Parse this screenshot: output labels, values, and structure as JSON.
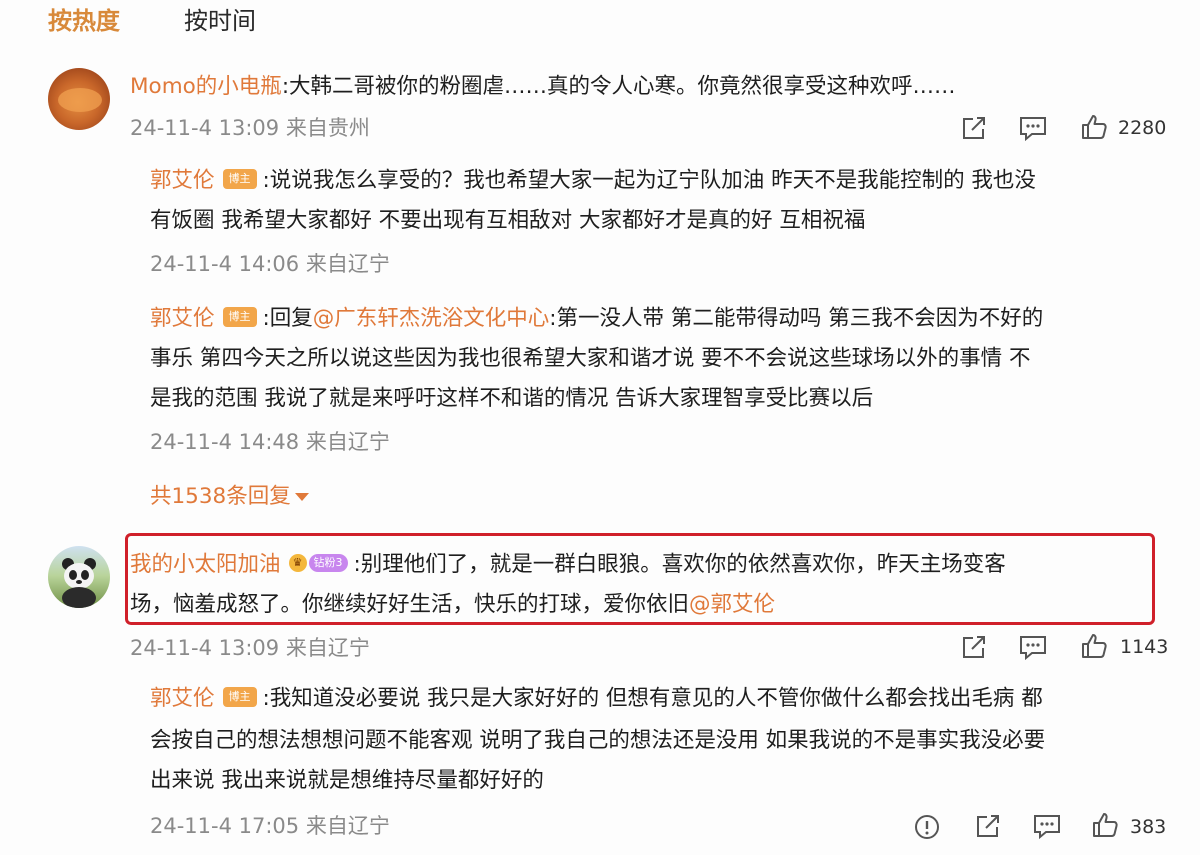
{
  "tabs": {
    "hot": "按热度",
    "time": "按时间"
  },
  "comments": [
    {
      "username": "Momo的小电瓶",
      "lines": [
        ":大韩二哥被你的粉圈虐……真的令人心寒。你竟然很享受这种欢呼……"
      ],
      "meta": "24-11-4 13:09 来自贵州",
      "likes": "2280",
      "replies": [
        {
          "username": "郭艾伦",
          "badge": "博主",
          "lines": [
            ":说说我怎么享受的？我也希望大家一起为辽宁队加油 昨天不是我能控制的 我也没",
            "有饭圈 我希望大家都好 不要出现有互相敌对 大家都好才是真的好 互相祝福"
          ],
          "meta": "24-11-4 14:06 来自辽宁"
        },
        {
          "username": "郭艾伦",
          "badge": "博主",
          "reply_prefix": ":回复",
          "mention": "@广东轩杰洗浴文化中心",
          "lines": [
            ":第一没人带 第二能带得动吗 第三我不会因为不好的",
            "事乐 第四今天之所以说这些因为我也很希望大家和谐才说 要不不会说这些球场以外的事情 不",
            "是我的范围 我说了就是来呼吁这样不和谐的情况 告诉大家理智享受比赛以后"
          ],
          "meta": "24-11-4 14:48 来自辽宁"
        }
      ],
      "more_replies": "共1538条回复"
    },
    {
      "username": "我的小太阳加油",
      "badge_level": "钻粉3",
      "lines": [
        ":别理他们了，就是一群白眼狼。喜欢你的依然喜欢你，昨天主场变客",
        "场，恼羞成怒了。你继续好好生活，快乐的打球，爱你依旧"
      ],
      "mention": "@郭艾伦",
      "meta": "24-11-4 13:09 来自辽宁",
      "likes": "1143",
      "replies": [
        {
          "username": "郭艾伦",
          "badge": "博主",
          "lines": [
            ":我知道没必要说 我只是大家好好的 但想有意见的人不管你做什么都会找出毛病 都",
            "会按自己的想法想想问题不能客观 说明了我自己的想法还是没用 如果我说的不是事实我没必要",
            "出来说 我出来说就是想维持尽量都好好的"
          ],
          "meta": "24-11-4 17:05 来自辽宁",
          "likes": "383"
        }
      ]
    }
  ],
  "colors": {
    "accent": "#e0793a",
    "badge": "#f2a64a",
    "highlight": "#d0202a",
    "meta": "#8a8a8a"
  },
  "icons": [
    "share-icon",
    "comment-icon",
    "like-icon",
    "report-icon"
  ]
}
